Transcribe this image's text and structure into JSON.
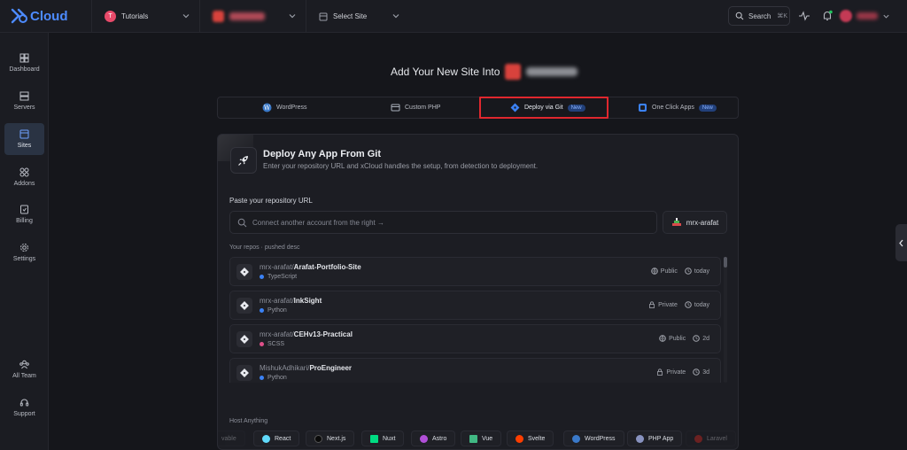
{
  "brand": {
    "name": "Cloud"
  },
  "breadcrumbs": {
    "team_initial": "T",
    "team": "Tutorials",
    "site": "Select Site"
  },
  "header": {
    "search_label": "Search",
    "search_shortcut": "⌘K"
  },
  "sidebar": {
    "items": [
      {
        "label": "Dashboard"
      },
      {
        "label": "Servers"
      },
      {
        "label": "Sites"
      },
      {
        "label": "Addons"
      },
      {
        "label": "Billing"
      },
      {
        "label": "Settings"
      },
      {
        "label": "All Team"
      },
      {
        "label": "Support"
      }
    ]
  },
  "main": {
    "title": "Add Your New Site Into",
    "tabs": [
      {
        "label": "WordPress"
      },
      {
        "label": "Custom PHP"
      },
      {
        "label": "Deploy via Git",
        "badge": "New"
      },
      {
        "label": "One Click Apps",
        "badge": "New"
      }
    ]
  },
  "card": {
    "title": "Deploy Any App From Git",
    "subtitle": "Enter your repository URL and xCloud handles the setup, from detection to deployment.",
    "repo_label": "Paste your repository URL",
    "repo_placeholder": "Connect another account from the right →",
    "account": "mrx-arafat",
    "repos_label": "Your repos · pushed desc",
    "repos": [
      {
        "owner": "mrx-arafat/",
        "name": "Arafat-Portfolio-Site",
        "lang": "TypeScript",
        "lang_color": "#3b82f6",
        "visibility": "Public",
        "time": "today"
      },
      {
        "owner": "mrx-arafat/",
        "name": "InkSight",
        "lang": "Python",
        "lang_color": "#3b82f6",
        "visibility": "Private",
        "time": "today"
      },
      {
        "owner": "mrx-arafat/",
        "name": "CEHv13-Practical",
        "lang": "SCSS",
        "lang_color": "#e0508a",
        "visibility": "Public",
        "time": "2d"
      },
      {
        "owner": "MishukAdhikari/",
        "name": "ProEngineer",
        "lang": "Python",
        "lang_color": "#3b82f6",
        "visibility": "Private",
        "time": "3d"
      }
    ],
    "host_label": "Host Anything",
    "chips": [
      {
        "label": "vable"
      },
      {
        "label": "React"
      },
      {
        "label": "Next.js"
      },
      {
        "label": "Nuxt"
      },
      {
        "label": "Astro"
      },
      {
        "label": "Vue"
      },
      {
        "label": "Svelte"
      },
      {
        "label": "WordPress"
      },
      {
        "label": "PHP App"
      },
      {
        "label": "Laravel"
      }
    ]
  }
}
